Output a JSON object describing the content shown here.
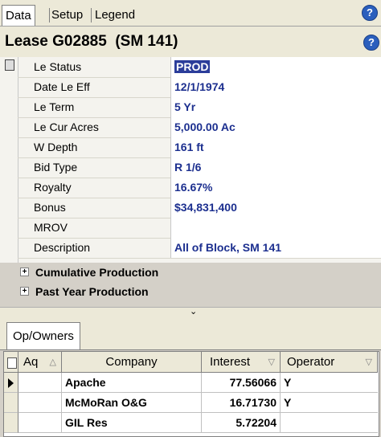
{
  "tabs": [
    "Data",
    "Setup",
    "Legend"
  ],
  "help_icon": "help-icon",
  "title": "Lease G02885  (SM 141)",
  "properties": [
    {
      "label": "Le Status",
      "value": "PROD"
    },
    {
      "label": "Date Le Eff",
      "value": "12/1/1974"
    },
    {
      "label": "Le Term",
      "value": "5 Yr"
    },
    {
      "label": "Le Cur Acres",
      "value": "5,000.00 Ac"
    },
    {
      "label": "W Depth",
      "value": "161 ft"
    },
    {
      "label": "Bid Type",
      "value": "R 1/6"
    },
    {
      "label": "Royalty",
      "value": "16.67%"
    },
    {
      "label": "Bonus",
      "value": "$34,831,400"
    },
    {
      "label": "MROV",
      "value": ""
    },
    {
      "label": "Description",
      "value": "All of Block, SM 141"
    }
  ],
  "groups": [
    {
      "label": "Cumulative Production",
      "expander": "+"
    },
    {
      "label": "Past Year Production",
      "expander": "+"
    }
  ],
  "bottom_tab": "Op/Owners",
  "owners": {
    "columns": [
      "Aq",
      "Company",
      "Interest",
      "Operator"
    ],
    "rows": [
      {
        "aq": "",
        "company": "Apache",
        "interest": "77.56066",
        "operator": "Y"
      },
      {
        "aq": "",
        "company": "McMoRan O&G",
        "interest": "16.71730",
        "operator": "Y"
      },
      {
        "aq": "",
        "company": "GIL Res",
        "interest": "5.72204",
        "operator": ""
      }
    ]
  },
  "colors": {
    "value_text": "#1c2f8f",
    "selection": "#2b3d9a",
    "chrome": "#ece9d8"
  }
}
